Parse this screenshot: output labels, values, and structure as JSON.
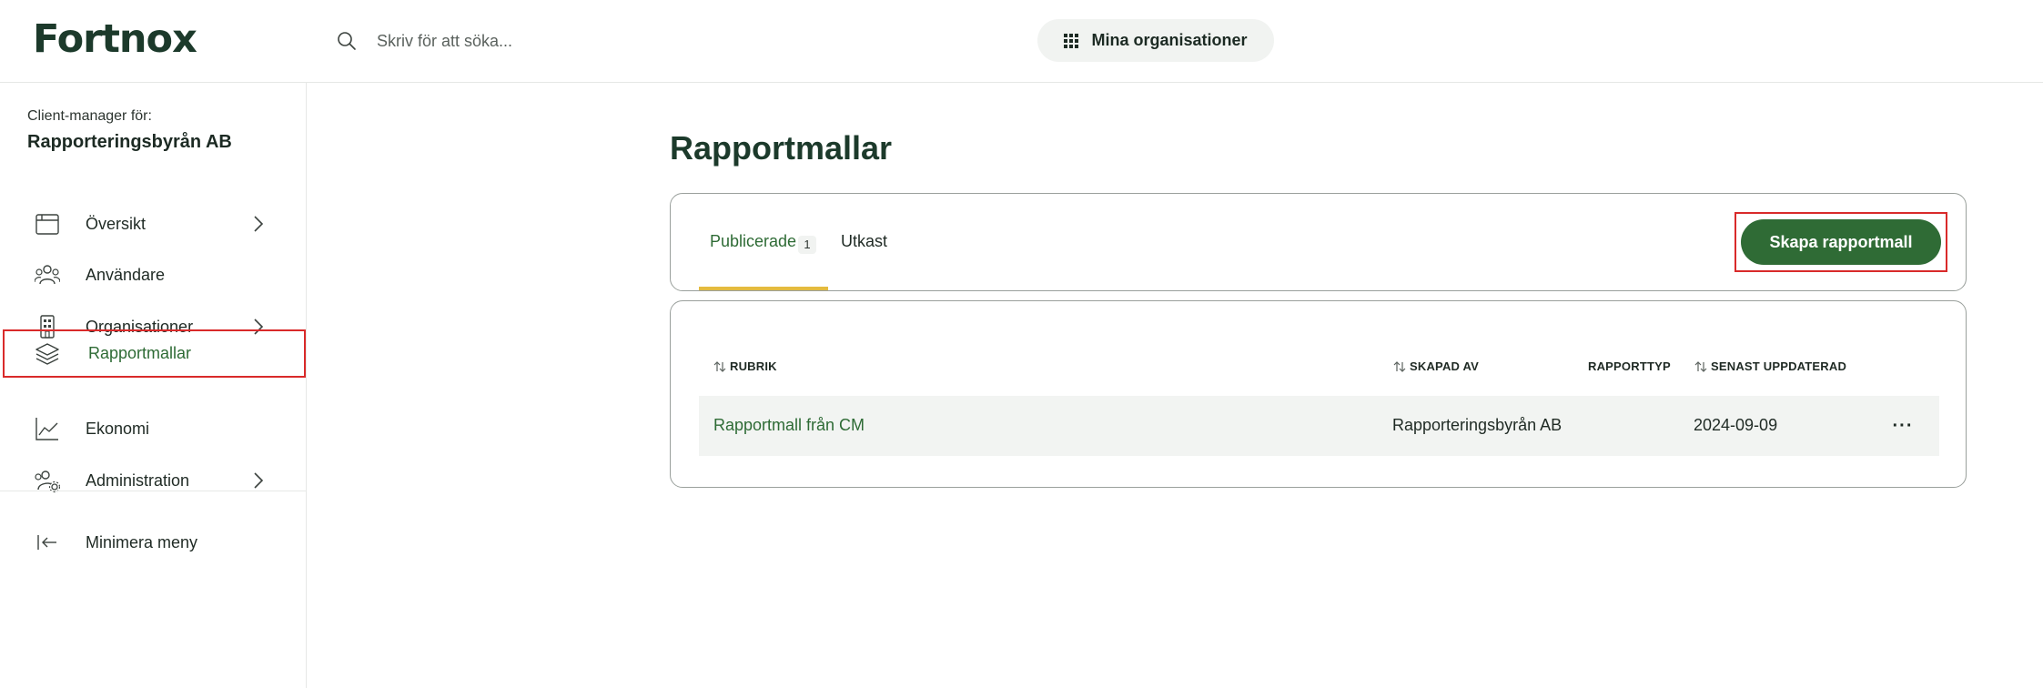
{
  "brand": {
    "logo_text": "Fortnox",
    "accent_color": "#2f6b35",
    "highlight_color": "#d92a2a",
    "tab_indicator_color": "#e4bb3f"
  },
  "header": {
    "search_placeholder": "Skriv för att söka...",
    "org_button_label": "Mina organisationer"
  },
  "sidebar": {
    "client_for_label": "Client-manager för:",
    "client_name": "Rapporteringsbyrån AB",
    "items": [
      {
        "label": "Översikt",
        "icon": "calendar-window-icon",
        "has_chevron": true
      },
      {
        "label": "Användare",
        "icon": "users-icon",
        "has_chevron": false
      },
      {
        "label": "Organisationer",
        "icon": "building-icon",
        "has_chevron": true
      },
      {
        "label": "Rapportmallar",
        "icon": "layers-icon",
        "has_chevron": false,
        "active": true
      },
      {
        "label": "Ekonomi",
        "icon": "line-chart-icon",
        "has_chevron": false
      },
      {
        "label": "Administration",
        "icon": "users-settings-icon",
        "has_chevron": true
      }
    ],
    "minimize_label": "Minimera meny"
  },
  "main": {
    "title": "Rapportmallar",
    "tabs": [
      {
        "label": "Publicerade",
        "count": "1",
        "active": true
      },
      {
        "label": "Utkast"
      }
    ],
    "create_button_label": "Skapa rapportmall",
    "table": {
      "columns": [
        "RUBRIK",
        "SKAPAD AV",
        "RAPPORTTYP",
        "SENAST UPPDATERAD"
      ],
      "rows": [
        {
          "rubrik": "Rapportmall från CM",
          "skapad_av": "Rapporteringsbyrån AB",
          "rapporttyp": "",
          "senast_uppdaterad": "2024-09-09",
          "more": "···"
        }
      ]
    }
  }
}
